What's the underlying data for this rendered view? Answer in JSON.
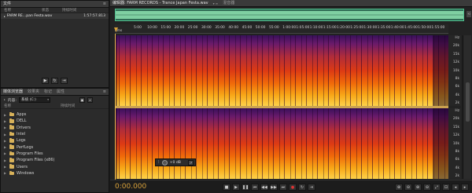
{
  "files_panel": {
    "tab_label": "文件",
    "col_name": "名称",
    "col_status": "状态",
    "col_duration": "持续时间",
    "file": {
      "name": "FARM RE...pan Festa.wav",
      "duration": "1:57:57.813"
    }
  },
  "media_panel": {
    "tabs": [
      "媒体浏览器",
      "效果夹",
      "标记",
      "属性"
    ],
    "contents_label": "内容:",
    "contents_value": "系统 (C:)",
    "col_name": "名称",
    "col_duration": "持续时间",
    "folders": [
      "Apps",
      "DELL",
      "Drivers",
      "Intel",
      "Logs",
      "PerfLogs",
      "Program Files",
      "Program Files (x86)",
      "Users",
      "Windows"
    ]
  },
  "editor": {
    "tab_label": "编辑器: FARM RECORDS - Trance Japan Festa.wav",
    "mixer_tab_label": "混音器",
    "ruler_unit": "hms",
    "ruler_labels": [
      "5:00",
      "10:00",
      "15:00",
      "20:00",
      "25:00",
      "30:00",
      "35:00",
      "40:00",
      "45:00",
      "50:00",
      "55:00",
      "1:00:00",
      "1:05:00",
      "1:10:00",
      "1:15:00",
      "1:20:00",
      "1:25:00",
      "1:30:00",
      "1:35:00",
      "1:40:00",
      "1:45:00",
      "1:50:00",
      "1:55:00"
    ],
    "hz_top": [
      "Hz",
      "20k",
      "15k",
      "12k",
      "10k",
      "8k",
      "6k",
      "4k",
      "2k"
    ],
    "hz_bottom": [
      "Hz",
      "20k",
      "15k",
      "12k",
      "10k",
      "8k",
      "6k",
      "4k",
      "2k"
    ],
    "hud_db": "+0 dB",
    "time_display": "0:00.000"
  },
  "colors": {
    "time_display": "#d8a13a",
    "overview_wave": "#7fcfa2",
    "folder": "#d8b25a"
  }
}
